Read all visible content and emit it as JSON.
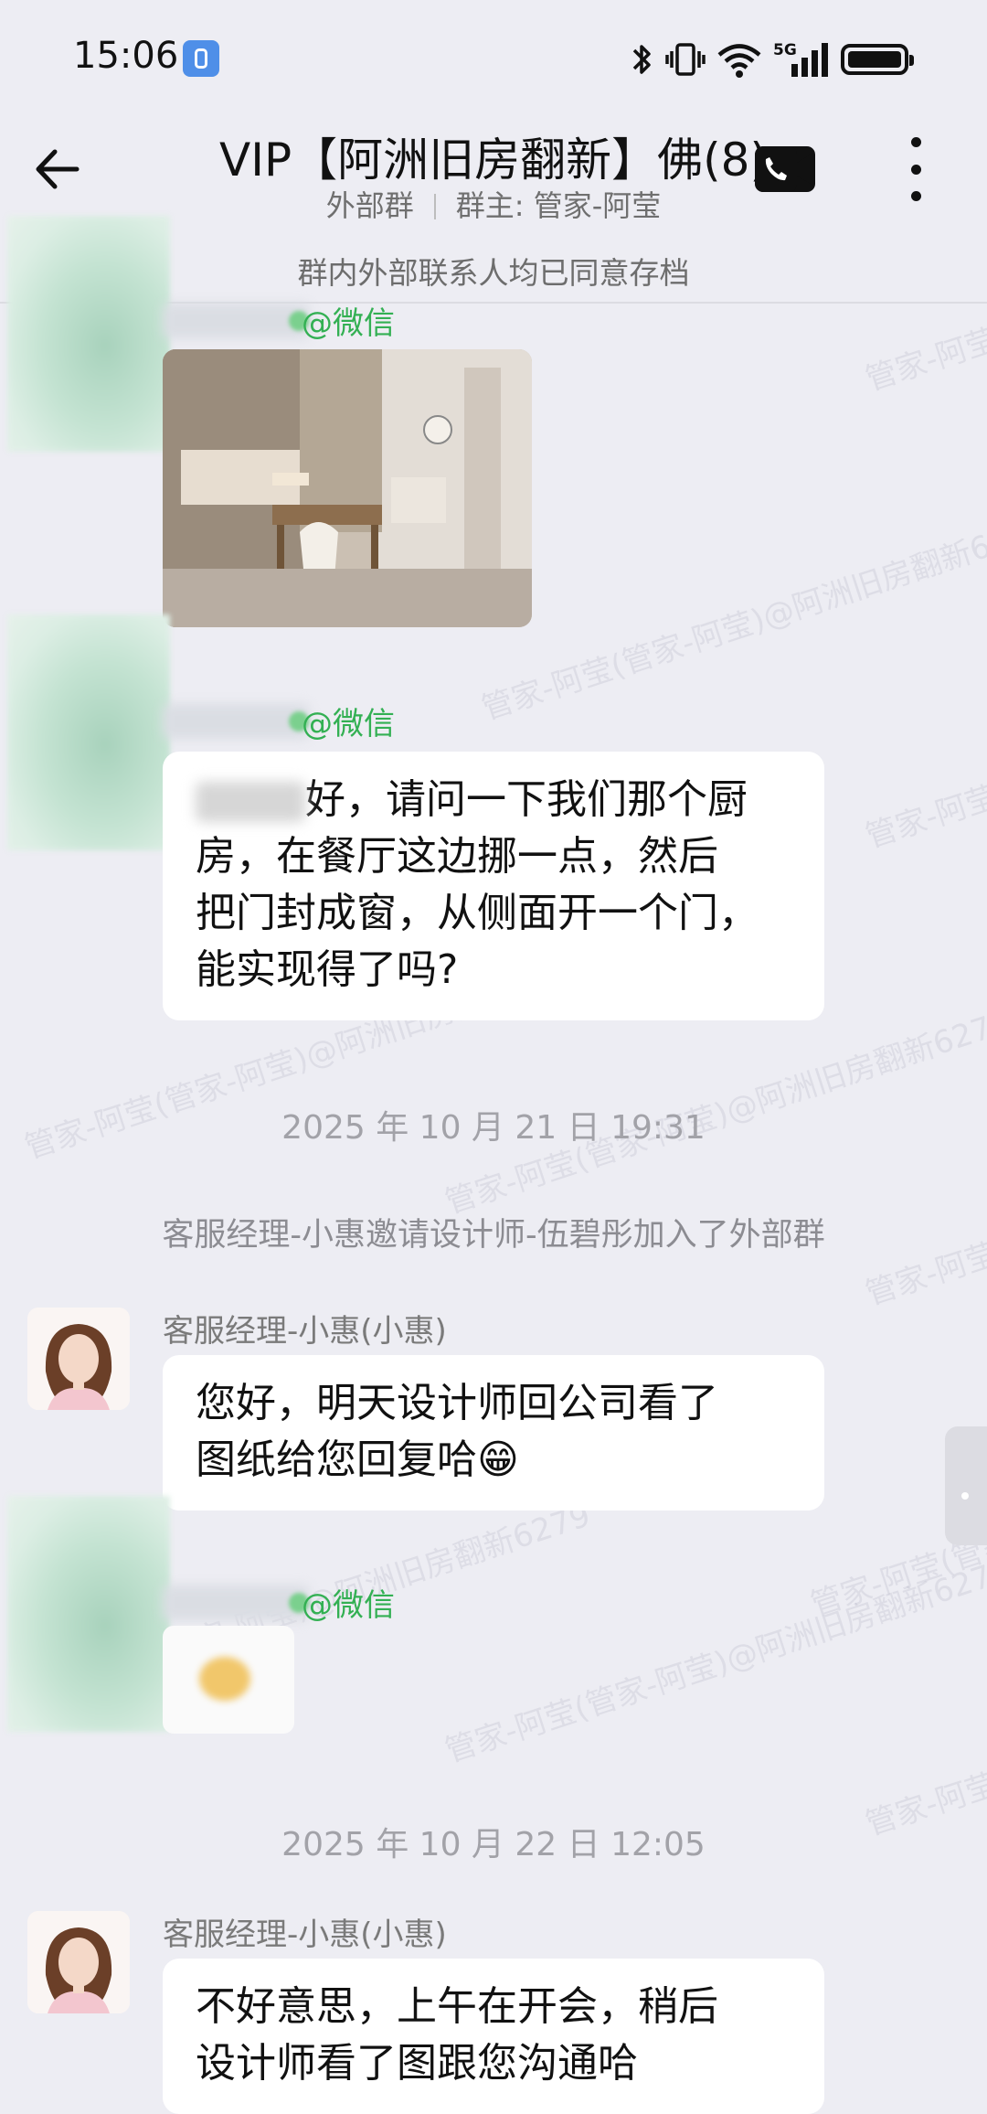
{
  "status_bar": {
    "time": "15:06",
    "icons": [
      "app-notification-icon",
      "bluetooth-icon",
      "vibrate-icon",
      "wifi-icon",
      "5g-signal-icon",
      "battery-icon"
    ],
    "network_label": "5G"
  },
  "header": {
    "title": "VIP【阿洲旧房翻新】佛(8)",
    "subtitle_type": "外部群",
    "subtitle_owner": "群主: 管家-阿莹"
  },
  "archive_notice": "群内外部联系人均已同意存档",
  "watermark_text": "管家-阿莹(管家-阿莹)@阿洲旧房翻新6279",
  "messages": {
    "m1": {
      "source_tag": "@微信",
      "type": "image"
    },
    "m2": {
      "source_tag": "@微信",
      "line1_rest": "好，请问一下我们那个厨",
      "line2_rest": "在餐厅这边挪一点，然后",
      "line2_prefix": "房，",
      "line3": "把门封成窗，从侧面开一个门，",
      "line4": "能实现得了吗?"
    },
    "ts1": "2025 年 10 月 21 日  19:31",
    "system1": "客服经理-小惠邀请设计师-伍碧彤加入了外部群",
    "m3": {
      "sender": "客服经理-小惠(小惠)",
      "line1": "您好，明天设计师回公司看了",
      "line2": "图纸给您回复哈",
      "emoji": "😁"
    },
    "m4": {
      "source_tag": "@微信",
      "type": "sticker"
    },
    "ts2": "2025 年 10 月 22 日  12:05",
    "m5": {
      "sender": "客服经理-小惠(小惠)",
      "line1": "不好意思，上午在开会，稍后",
      "line2": "设计师看了图跟您沟通哈"
    }
  },
  "colors": {
    "background": "#ededf3",
    "bubble": "#ffffff",
    "wechat_green": "#33b053",
    "timestamp": "#a2a2a8"
  }
}
